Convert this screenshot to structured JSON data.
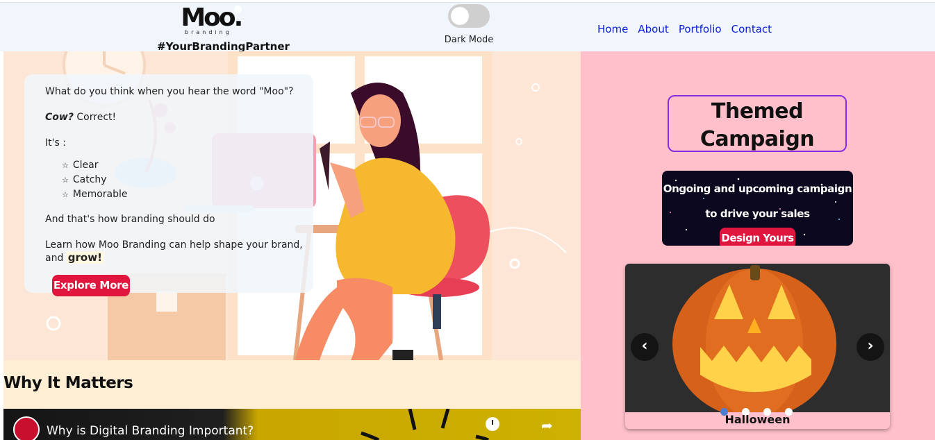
{
  "header": {
    "logo_word": "Moo",
    "logo_dot": ".",
    "logo_sub": "branding",
    "tagline": "#YourBrandingPartner",
    "dark_mode_label": "Dark Mode",
    "dark_mode_on": false,
    "nav": [
      "Home",
      "About",
      "Portfolio",
      "Contact"
    ]
  },
  "intro": {
    "question": "What do you think when you hear the word \"Moo\"?",
    "cow": "Cow?",
    "correct": "Correct!",
    "its": "It's :",
    "qualities": [
      "Clear",
      "Catchy",
      "Memorable"
    ],
    "bullet_icon": "star-outline-icon",
    "conclusion": "And that's how branding should do",
    "learn": "Learn how Moo Branding can help shape your brand, and",
    "grow": "grow!",
    "explore_label": "Explore More"
  },
  "matters": {
    "heading": "Why It Matters",
    "video_title": "Why is Digital Branding Important?"
  },
  "themed": {
    "title_line1": "Themed",
    "title_line2": "Campaign",
    "campaign_line1": "Ongoing and upcoming campaign",
    "campaign_line2": "to drive your sales",
    "design_label": "Design Yours"
  },
  "carousel": {
    "prev_glyph": "‹",
    "next_glyph": "›",
    "slides": 4,
    "active_slide": 1,
    "caption": "Halloween"
  },
  "colors": {
    "accent_red": "#e0163f",
    "nav_blue": "#0a1fd1",
    "pink_bg": "#ffc0cb",
    "header_bg": "#f0f6fc",
    "border_purple": "#8a2be2"
  }
}
